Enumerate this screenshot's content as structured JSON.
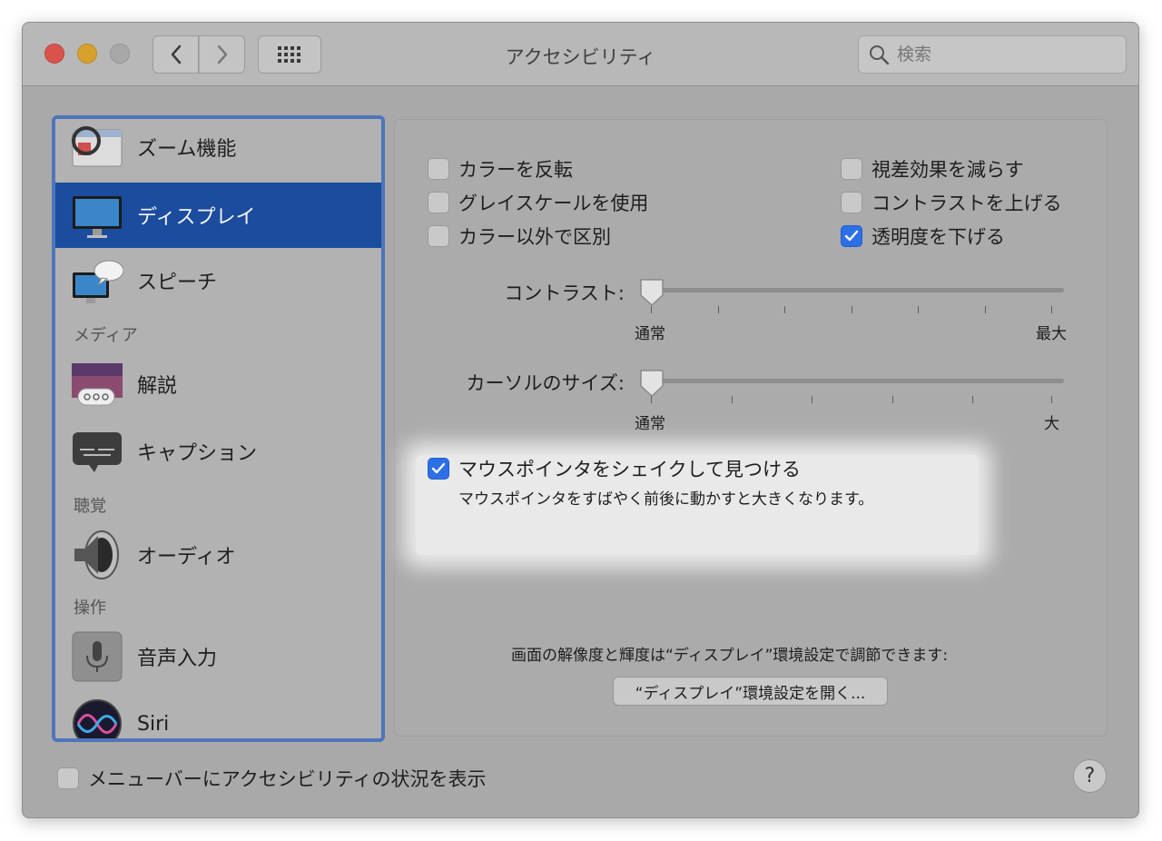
{
  "window": {
    "title": "アクセシビリティ"
  },
  "search": {
    "placeholder": "検索"
  },
  "sidebar": {
    "items": [
      {
        "label": "ズーム機能",
        "icon": "zoom-icon"
      },
      {
        "label": "ディスプレイ",
        "icon": "display-icon",
        "selected": true
      },
      {
        "label": "スピーチ",
        "icon": "speech-icon"
      },
      {
        "label": "解説",
        "icon": "descriptions-icon"
      },
      {
        "label": "キャプション",
        "icon": "captions-icon"
      },
      {
        "label": "オーディオ",
        "icon": "audio-icon"
      },
      {
        "label": "音声入力",
        "icon": "voice-control-icon"
      },
      {
        "label": "Siri",
        "icon": "siri-icon"
      }
    ],
    "sections": {
      "media": "メディア",
      "hearing": "聴覚",
      "interaction": "操作"
    }
  },
  "display": {
    "checkboxes": {
      "invert_colors": {
        "label": "カラーを反転",
        "checked": false
      },
      "grayscale": {
        "label": "グレイスケールを使用",
        "checked": false
      },
      "differentiate": {
        "label": "カラー以外で区別",
        "checked": false
      },
      "reduce_motion": {
        "label": "視差効果を減らす",
        "checked": false
      },
      "increase_contrast": {
        "label": "コントラストを上げる",
        "checked": false
      },
      "reduce_transparency": {
        "label": "透明度を下げる",
        "checked": true
      }
    },
    "contrast": {
      "label": "コントラスト:",
      "min_label": "通常",
      "max_label": "最大",
      "value": 0
    },
    "cursor_size": {
      "label": "カーソルのサイズ:",
      "min_label": "通常",
      "max_label": "大",
      "value": 0
    },
    "shake": {
      "label": "マウスポインタをシェイクして見つける",
      "description": "マウスポインタをすばやく前後に動かすと大きくなります。",
      "checked": true
    },
    "info_text": "画面の解像度と輝度は“ディスプレイ”環境設定で調節できます:",
    "open_button": "“ディスプレイ”環境設定を開く..."
  },
  "footer": {
    "menubar_checkbox": {
      "label": "メニューバーにアクセシビリティの状況を表示",
      "checked": false
    },
    "help": "?"
  },
  "colors": {
    "accent": "#2d6fe6",
    "selection": "#1b4c9e",
    "close": "#d9534d",
    "minimize": "#d7a22c"
  }
}
